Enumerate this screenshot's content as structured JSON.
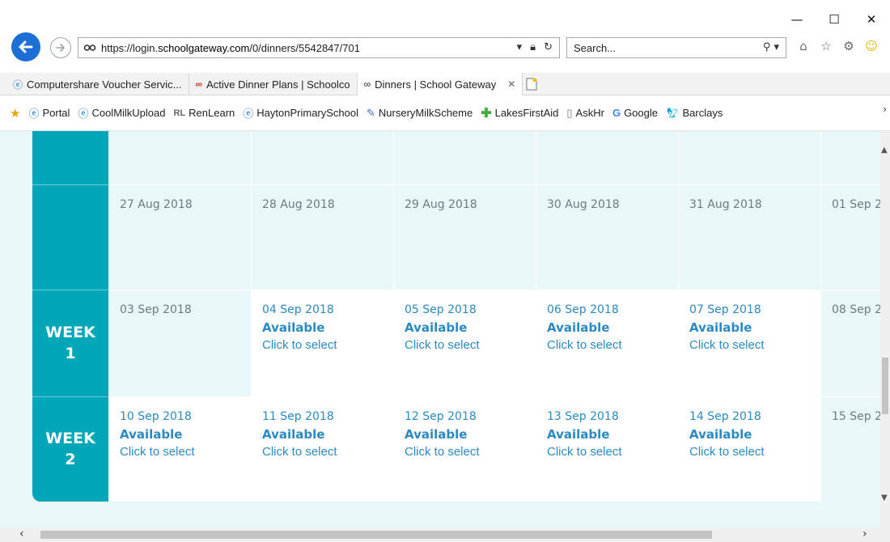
{
  "window": {
    "min_label": "—",
    "max_label": "☐",
    "close_label": "✕"
  },
  "nav": {
    "url_prefix": "https://login.",
    "url_host": "schoolgateway.com",
    "url_path": "/0/dinners/5542847/701",
    "search_placeholder": "Search..."
  },
  "tabs": [
    {
      "label": "Computershare Voucher Servic...",
      "icon": "ie-icon"
    },
    {
      "label": "Active Dinner Plans | Schoolco",
      "icon": "schoolco-icon"
    },
    {
      "label": "Dinners | School Gateway",
      "icon": "schoolgateway-icon",
      "active": true
    }
  ],
  "favorites": [
    {
      "label": "Portal",
      "icon": "ie-icon"
    },
    {
      "label": "CoolMilkUpload",
      "icon": "ie-icon"
    },
    {
      "label": "RenLearn",
      "icon": "renlearn-icon"
    },
    {
      "label": "HaytonPrimarySchool",
      "icon": "ie-icon"
    },
    {
      "label": "NurseryMilkScheme",
      "icon": "pencil-icon"
    },
    {
      "label": "LakesFirstAid",
      "icon": "cross-icon"
    },
    {
      "label": "AskHr",
      "icon": "page-icon"
    },
    {
      "label": "Google",
      "icon": "google-icon"
    },
    {
      "label": "Barclays",
      "icon": "barclays-icon"
    }
  ],
  "calendar": {
    "weeks": [
      {
        "label_line1": "",
        "label_line2": ""
      },
      {
        "label_line1": "",
        "label_line2": ""
      },
      {
        "label_line1": "WEEK",
        "label_line2": "1"
      },
      {
        "label_line1": "WEEK",
        "label_line2": "2"
      }
    ],
    "rows": [
      {
        "cells": [
          {
            "date": "",
            "open": false
          },
          {
            "date": "",
            "open": false
          },
          {
            "date": "",
            "open": false
          },
          {
            "date": "",
            "open": false
          },
          {
            "date": "",
            "open": false
          },
          {
            "date": "",
            "open": false
          }
        ]
      },
      {
        "cells": [
          {
            "date": "27 Aug 2018",
            "open": false
          },
          {
            "date": "28 Aug 2018",
            "open": false
          },
          {
            "date": "29 Aug 2018",
            "open": false
          },
          {
            "date": "30 Aug 2018",
            "open": false
          },
          {
            "date": "31 Aug 2018",
            "open": false
          },
          {
            "date": "01 Sep 2",
            "open": false
          }
        ]
      },
      {
        "cells": [
          {
            "date": "03 Sep 2018",
            "open": false
          },
          {
            "date": "04 Sep 2018",
            "open": true,
            "status": "Available",
            "action": "Click to select"
          },
          {
            "date": "05 Sep 2018",
            "open": true,
            "status": "Available",
            "action": "Click to select"
          },
          {
            "date": "06 Sep 2018",
            "open": true,
            "status": "Available",
            "action": "Click to select"
          },
          {
            "date": "07 Sep 2018",
            "open": true,
            "status": "Available",
            "action": "Click to select"
          },
          {
            "date": "08 Sep 2",
            "open": false
          }
        ]
      },
      {
        "cells": [
          {
            "date": "10 Sep 2018",
            "open": true,
            "status": "Available",
            "action": "Click to select"
          },
          {
            "date": "11 Sep 2018",
            "open": true,
            "status": "Available",
            "action": "Click to select"
          },
          {
            "date": "12 Sep 2018",
            "open": true,
            "status": "Available",
            "action": "Click to select"
          },
          {
            "date": "13 Sep 2018",
            "open": true,
            "status": "Available",
            "action": "Click to select"
          },
          {
            "date": "14 Sep 2018",
            "open": true,
            "status": "Available",
            "action": "Click to select"
          },
          {
            "date": "15 Sep 2",
            "open": false
          }
        ]
      }
    ]
  },
  "colors": {
    "brand_teal": "#00a7b8",
    "link_blue": "#2b8ac2",
    "page_bg": "#eaf7f8"
  }
}
